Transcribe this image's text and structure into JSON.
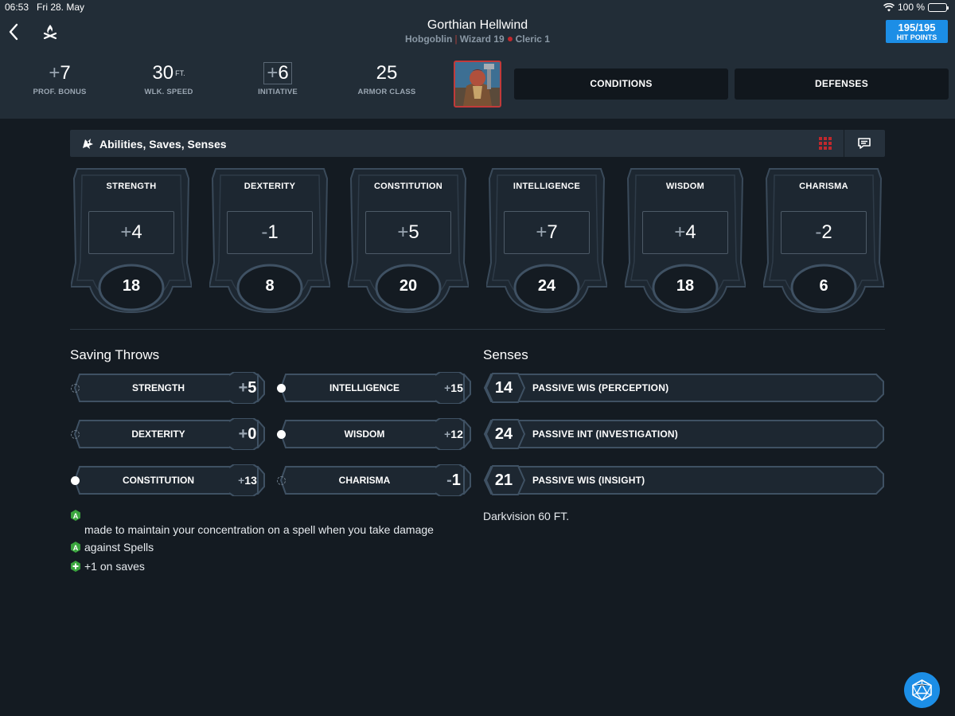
{
  "status_bar": {
    "time": "06:53",
    "date": "Fri 28. May",
    "battery": "100 %"
  },
  "character": {
    "name": "Gorthian Hellwind",
    "race": "Hobgoblin",
    "class_1": "Wizard 19",
    "class_2": "Cleric 1"
  },
  "hit_points": {
    "value": "195/195",
    "label": "HIT POINTS"
  },
  "stats": [
    {
      "sign": "+",
      "value": "7",
      "unit": "",
      "label": "PROF. BONUS"
    },
    {
      "sign": "",
      "value": "30",
      "unit": "FT.",
      "label": "WLK. SPEED"
    },
    {
      "sign": "+",
      "value": "6",
      "unit": "",
      "label": "INITIATIVE"
    },
    {
      "sign": "",
      "value": "25",
      "unit": "",
      "label": "ARMOR CLASS"
    }
  ],
  "buttons": {
    "conditions": "CONDITIONS",
    "defenses": "DEFENSES"
  },
  "section": {
    "title": "Abilities, Saves, Senses"
  },
  "abilities": [
    {
      "name": "STRENGTH",
      "sign": "+",
      "mod": "4",
      "score": "18"
    },
    {
      "name": "DEXTERITY",
      "sign": "-",
      "mod": "1",
      "score": "8"
    },
    {
      "name": "CONSTITUTION",
      "sign": "+",
      "mod": "5",
      "score": "20"
    },
    {
      "name": "INTELLIGENCE",
      "sign": "+",
      "mod": "7",
      "score": "24"
    },
    {
      "name": "WISDOM",
      "sign": "+",
      "mod": "4",
      "score": "18"
    },
    {
      "name": "CHARISMA",
      "sign": "-",
      "mod": "2",
      "score": "6"
    }
  ],
  "saving_throws": {
    "title": "Saving Throws",
    "items": [
      {
        "name": "STRENGTH",
        "sign": "+",
        "value": "5",
        "proficient": false
      },
      {
        "name": "DEXTERITY",
        "sign": "+",
        "value": "0",
        "proficient": false
      },
      {
        "name": "CONSTITUTION",
        "sign": "+",
        "value": "13",
        "proficient": true
      },
      {
        "name": "INTELLIGENCE",
        "sign": "+",
        "value": "15",
        "proficient": true
      },
      {
        "name": "WISDOM",
        "sign": "+",
        "value": "12",
        "proficient": true
      },
      {
        "name": "CHARISMA",
        "sign": "-",
        "value": "1",
        "proficient": false
      }
    ]
  },
  "senses": {
    "title": "Senses",
    "items": [
      {
        "value": "14",
        "name": "PASSIVE WIS (PERCEPTION)"
      },
      {
        "value": "24",
        "name": "PASSIVE INT (INVESTIGATION)"
      },
      {
        "value": "21",
        "name": "PASSIVE WIS (INSIGHT)"
      }
    ],
    "note": "Darkvision 60 FT."
  },
  "save_notes": [
    {
      "icon": "advantage-icon",
      "text": "made to maintain your concentration on a spell when you take damage"
    },
    {
      "icon": "advantage-icon",
      "text": "against Spells"
    },
    {
      "icon": "bonus-icon",
      "text": "+1 on saves"
    }
  ],
  "colors": {
    "accent": "#1c8ee6",
    "header_bg": "#222d37",
    "page_bg": "#141b22",
    "advantage": "#3aa53e",
    "portrait_border": "#c23a3a"
  }
}
